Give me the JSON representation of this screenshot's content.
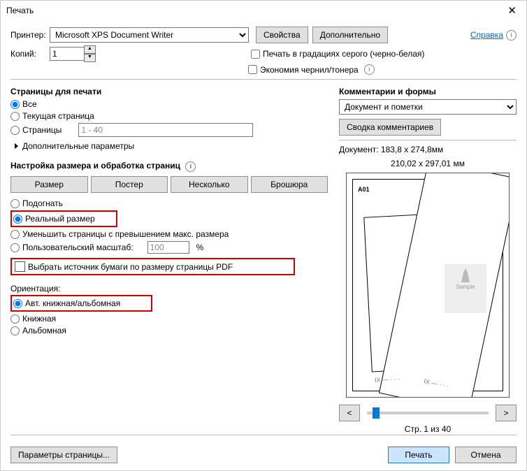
{
  "title": "Печать",
  "help": "Справка",
  "printer": {
    "label": "Принтер:",
    "value": "Microsoft XPS Document Writer",
    "props_btn": "Свойства",
    "adv_btn": "Дополнительно"
  },
  "copies": {
    "label": "Копий:",
    "value": "1"
  },
  "opts": {
    "grayscale": "Печать в градациях серого (черно-белая)",
    "ink": "Экономия чернил/тонера"
  },
  "pages": {
    "title": "Страницы для печати",
    "all": "Все",
    "current": "Текущая страница",
    "range": "Страницы",
    "range_ph": "1 - 40",
    "more": "Дополнительные параметры"
  },
  "sizing": {
    "title": "Настройка размера и обработка страниц",
    "b1": "Размер",
    "b2": "Постер",
    "b3": "Несколько",
    "b4": "Брошюра",
    "fit": "Подогнать",
    "actual": "Реальный размер",
    "shrink": "Уменьшить страницы с превышением макс. размера",
    "custom": "Пользовательский масштаб:",
    "custom_val": "100",
    "pct": "%",
    "source": "Выбрать источник бумаги по размеру страницы PDF"
  },
  "orient": {
    "title": "Ориентация:",
    "auto": "Авт. книжная/альбомная",
    "portrait": "Книжная",
    "landscape": "Альбомная"
  },
  "cf": {
    "title": "Комментарии и формы",
    "value": "Документ и пометки",
    "summary": "Сводка комментариев"
  },
  "preview": {
    "doc": "Документ: 183,8 x 274,8мм",
    "paper": "210,02 x 297,01 мм",
    "tag": "A01",
    "of": "Стр. 1 из 40",
    "prev": "<",
    "next": ">"
  },
  "footer": {
    "setup": "Параметры страницы...",
    "print": "Печать",
    "cancel": "Отмена"
  }
}
